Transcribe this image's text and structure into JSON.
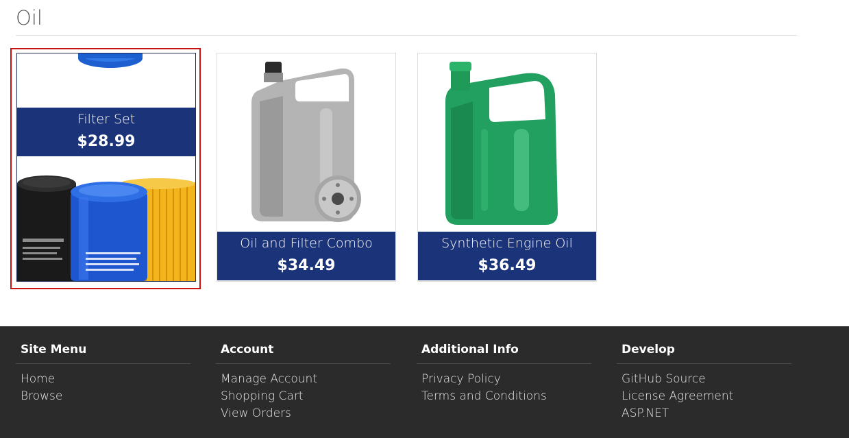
{
  "page": {
    "title": "Oil"
  },
  "products": [
    {
      "name": "Filter Set",
      "price": "$28.99",
      "image": "oil-filters-image",
      "selected": true
    },
    {
      "name": "Oil and Filter Combo",
      "price": "$34.49",
      "image": "silver-oil-jug-with-filter-image",
      "selected": false
    },
    {
      "name": "Synthetic Engine Oil",
      "price": "$36.49",
      "image": "green-oil-jug-image",
      "selected": false
    }
  ],
  "footer": {
    "columns": [
      {
        "heading": "Site Menu",
        "links": [
          "Home",
          "Browse"
        ]
      },
      {
        "heading": "Account",
        "links": [
          "Manage Account",
          "Shopping Cart",
          "View Orders"
        ]
      },
      {
        "heading": "Additional Info",
        "links": [
          "Privacy Policy",
          "Terms and Conditions"
        ]
      },
      {
        "heading": "Develop",
        "links": [
          "GitHub Source",
          "License Agreement",
          "ASP.NET"
        ]
      }
    ]
  },
  "colors": {
    "band": "#1b3378",
    "footer_bg": "#2b2b2b",
    "selection": "#cc1111"
  }
}
